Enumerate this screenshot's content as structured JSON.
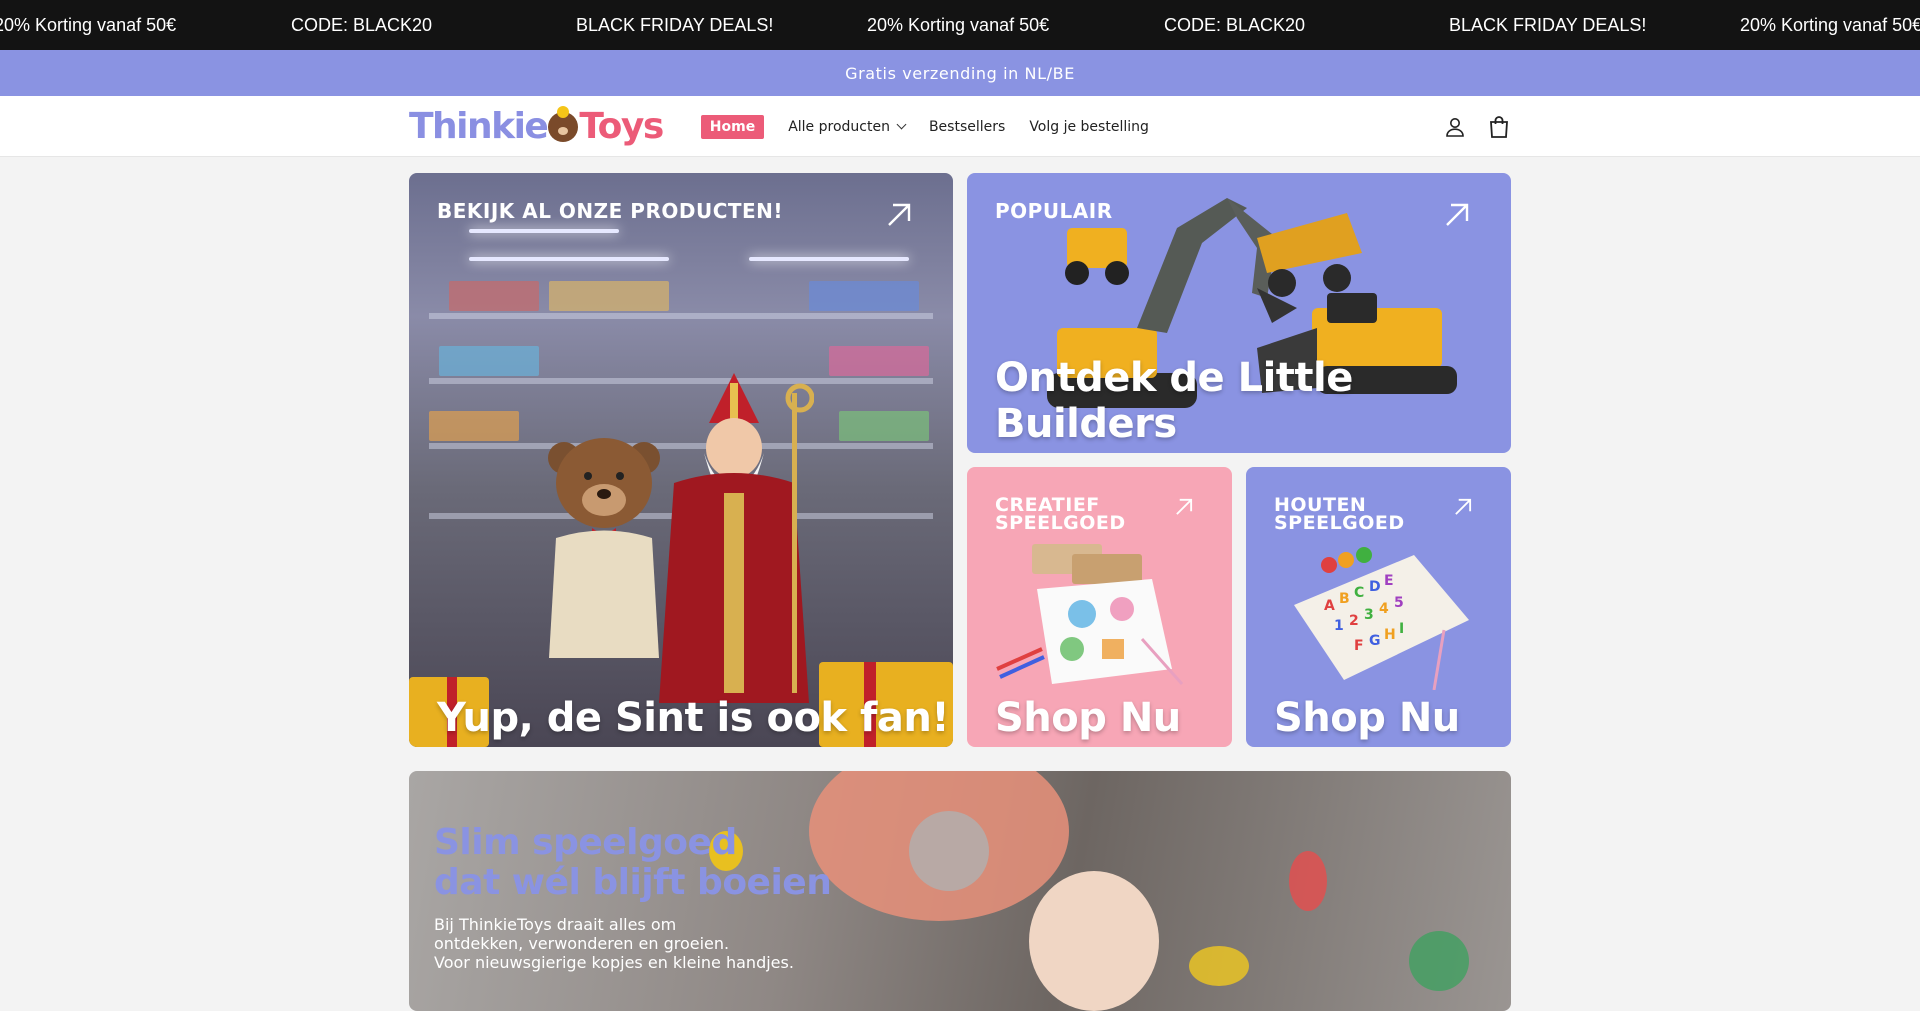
{
  "ticker": {
    "items": [
      "20% Korting vanaf 50€",
      "CODE: BLACK20",
      "BLACK FRIDAY DEALS!",
      "20% Korting vanaf 50€",
      "CODE: BLACK20",
      "BLACK FRIDAY DEALS!",
      "20% Korting vanaf 50€"
    ]
  },
  "shipping": {
    "text": "Gratis verzending in NL/BE"
  },
  "header": {
    "logo": {
      "part1": "Thinkie",
      "part2": "Toys"
    },
    "nav": [
      {
        "label": "Home",
        "active": true
      },
      {
        "label": "Alle producten",
        "dropdown": true
      },
      {
        "label": "Bestsellers"
      },
      {
        "label": "Volg je bestelling"
      }
    ],
    "icons": [
      "account-icon",
      "cart-icon"
    ]
  },
  "tiles": {
    "big": {
      "label": "BEKIJK AL ONZE PRODUCTEN!",
      "title": "Yup, de Sint is ook fan!"
    },
    "popular": {
      "label": "POPULAIR",
      "title": "Ontdek de Little Builders"
    },
    "creative": {
      "label_line1": "CREATIEF",
      "label_line2": "SPEELGOED",
      "title": "Shop Nu"
    },
    "wooden": {
      "label_line1": "HOUTEN",
      "label_line2": "SPEELGOED",
      "title": "Shop Nu"
    }
  },
  "banner": {
    "title_line1": "Slim speelgoed",
    "title_line2": "dat wél blijft boeien",
    "text_line1": "Bij ThinkieToys draait alles om",
    "text_line2": "ontdekken, verwonderen en groeien.",
    "text_line3": "Voor nieuwsgierige kopjes en kleine handjes."
  },
  "colors": {
    "accent_purple": "#8a93e2",
    "accent_pink": "#ec5b78",
    "ticker_bg": "#131313",
    "tile_pink": "#f7a6b6"
  }
}
